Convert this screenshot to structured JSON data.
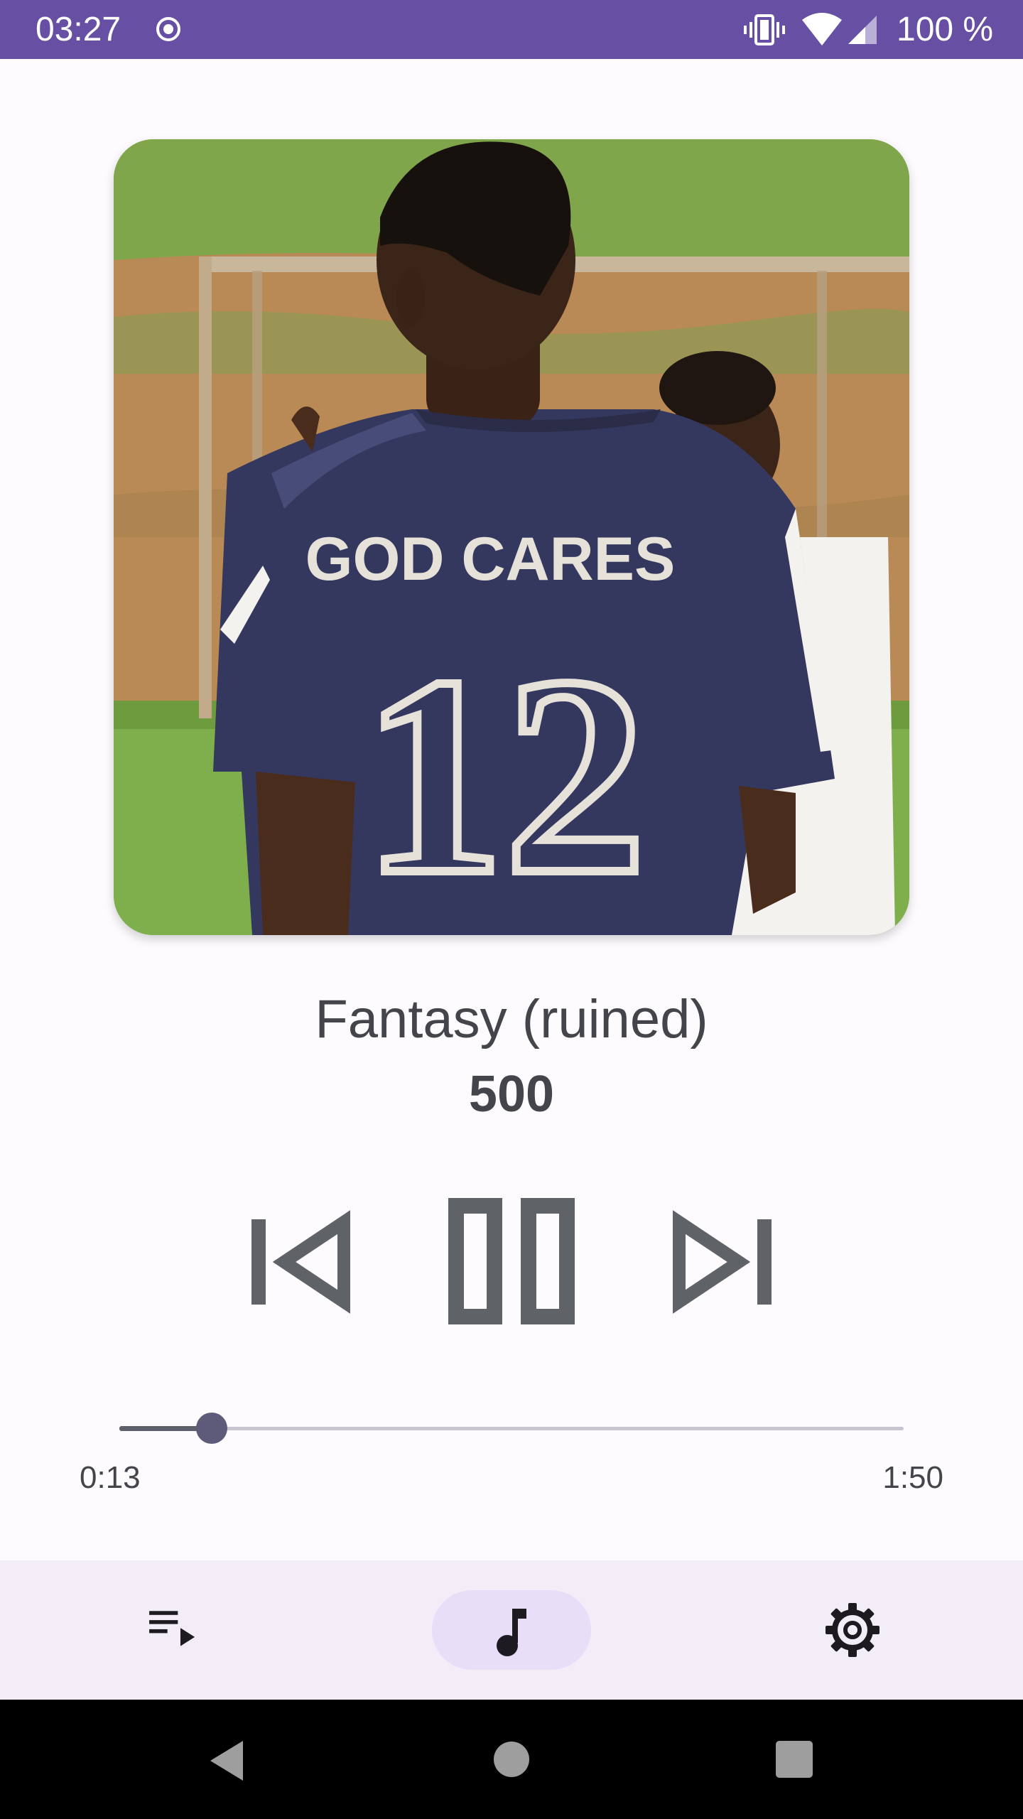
{
  "status_bar": {
    "time": "03:27",
    "battery": "100 %",
    "icons": [
      "record-icon",
      "vibrate-icon",
      "wifi-icon",
      "signal-icon"
    ]
  },
  "album_art": {
    "jersey_text": "GOD CARES",
    "jersey_number": "12"
  },
  "track": {
    "title": "Fantasy (ruined)",
    "artist": "500"
  },
  "controls": {
    "icons": [
      "skip-previous-icon",
      "pause-icon",
      "skip-next-icon"
    ]
  },
  "progress": {
    "elapsed": "0:13",
    "total": "1:50",
    "fraction": 0.118
  },
  "bottom_nav": {
    "items": [
      {
        "icon": "queue-icon",
        "selected": false
      },
      {
        "icon": "music-note-icon",
        "selected": true
      },
      {
        "icon": "gear-icon",
        "selected": false
      }
    ]
  },
  "system_nav": {
    "icons": [
      "back-icon",
      "home-icon",
      "recents-icon"
    ]
  },
  "colors": {
    "status_bar": "#6750a4",
    "background": "#fefbff",
    "text": "#44454b",
    "controls": "#5f6368",
    "nav_background": "#f2edf7",
    "nav_active_pill": "#e8def8",
    "seek_thumb": "#5d5a7a"
  }
}
